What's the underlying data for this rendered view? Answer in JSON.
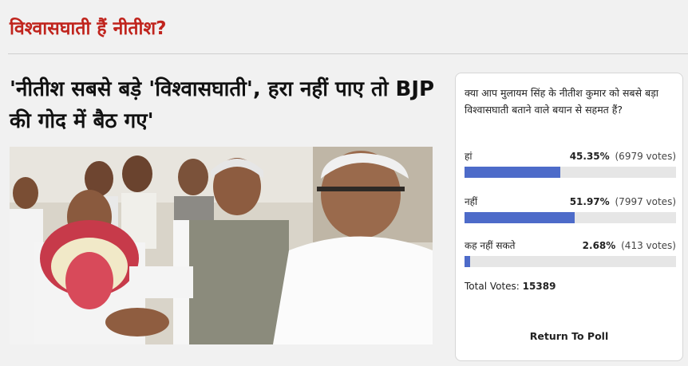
{
  "section": {
    "title": "विश्वासघाती हैं नीतीश?"
  },
  "article": {
    "headline": "'नीतीश सबसे बड़े 'विश्वासघाती', हरा नहीं पाए तो BJP की गोद में बैठ गए'"
  },
  "poll": {
    "question": "क्या आप मुलायम सिंह के नीतीश कुमार को सबसे बड़ा विश्वासघाती बताने वाले बयान से सहमत हैं?",
    "options": [
      {
        "label": "हां",
        "percent": "45.35%",
        "votes": "(6979 votes)",
        "fraction": 0.4535
      },
      {
        "label": "नहीं",
        "percent": "51.97%",
        "votes": "(7997 votes)",
        "fraction": 0.5197
      },
      {
        "label": "कह नहीं सकते",
        "percent": "2.68%",
        "votes": "(413 votes)",
        "fraction": 0.0268
      }
    ],
    "total_label": "Total Votes:",
    "total_value": "15389",
    "return_label": "Return To Poll"
  },
  "colors": {
    "title_red": "#c0241d",
    "bar_blue": "#4d6bc9",
    "bar_track": "#e6e6e6"
  }
}
